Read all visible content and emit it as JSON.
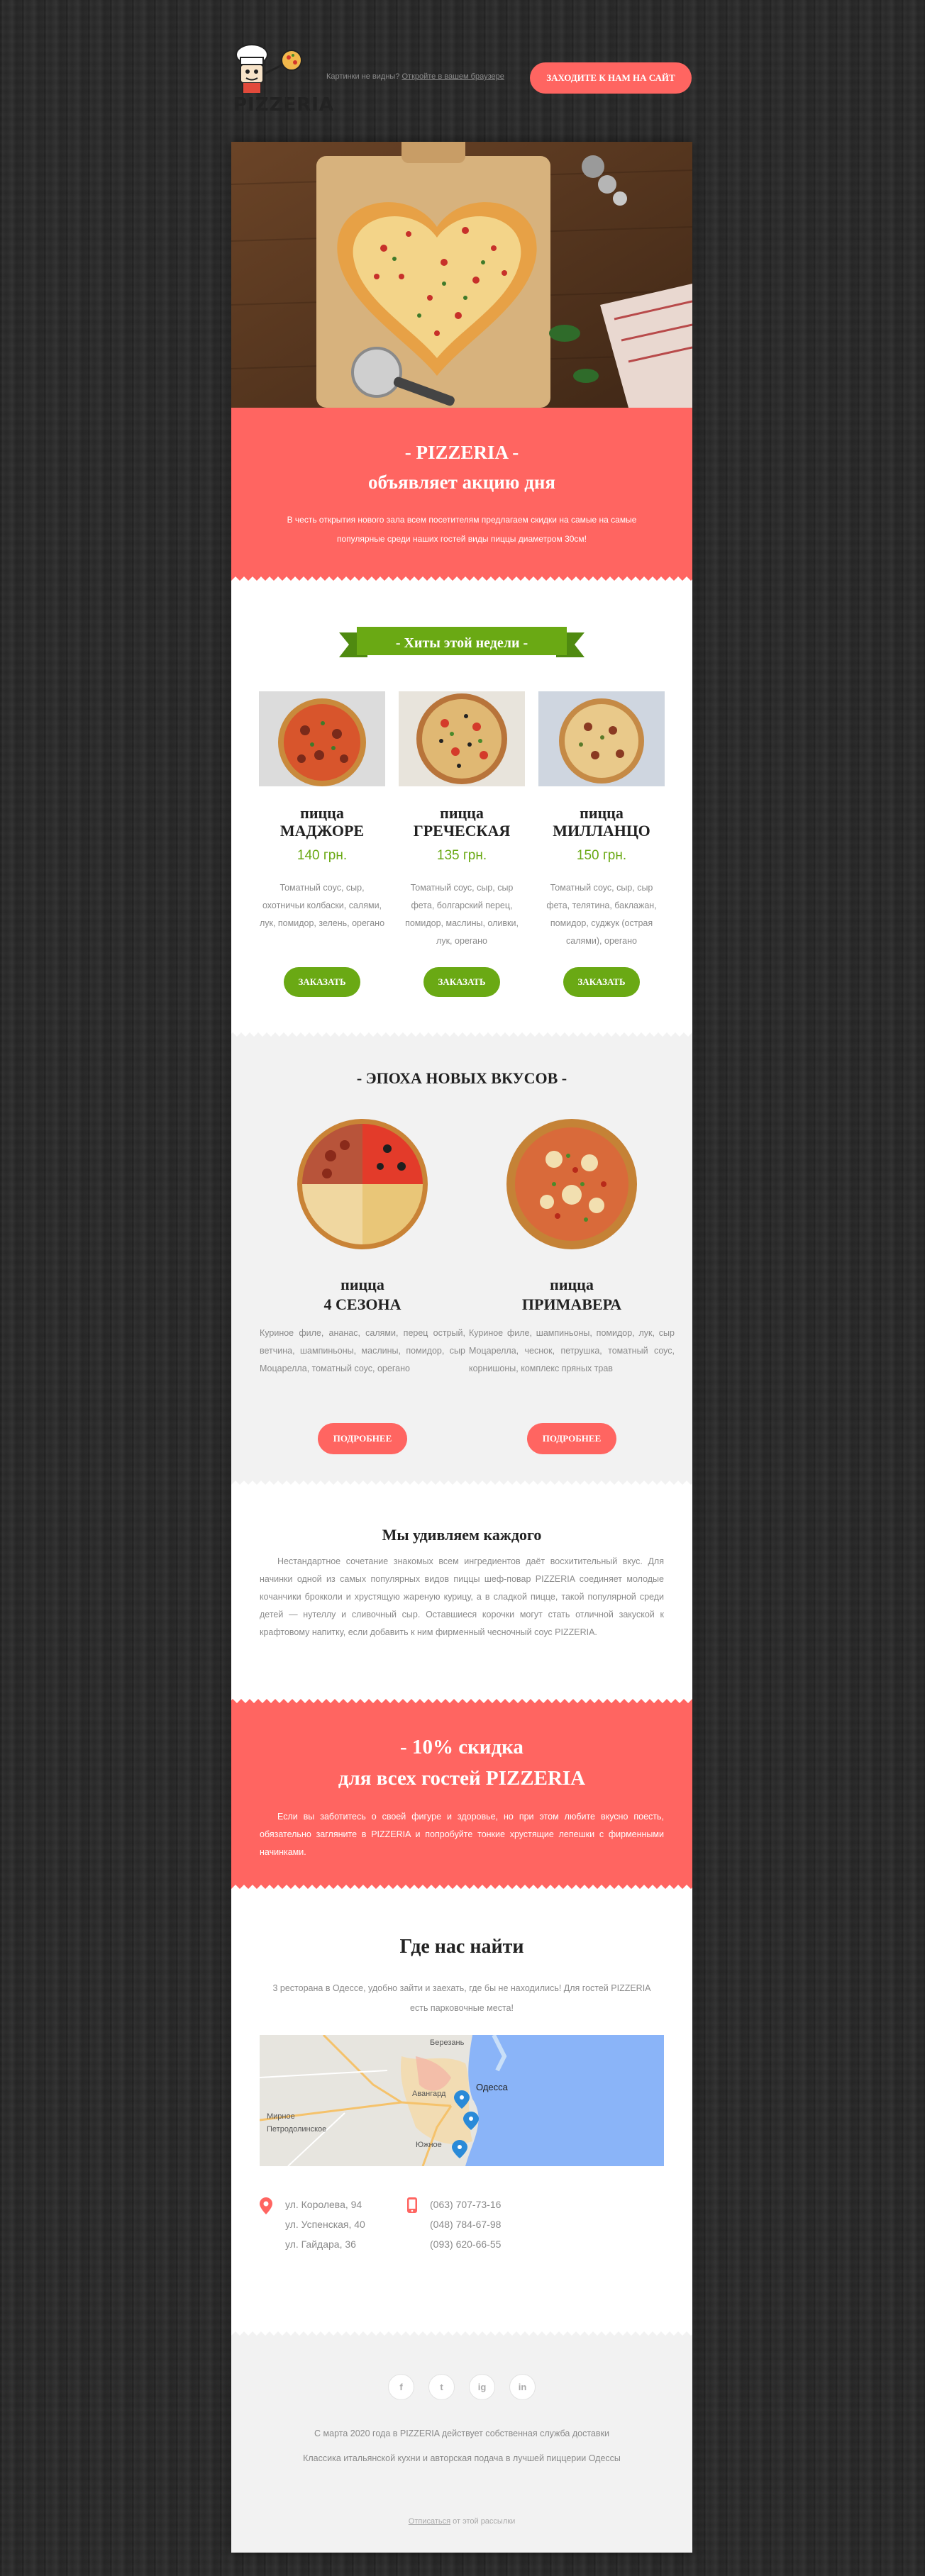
{
  "header": {
    "logo_text": "PIZZERIA",
    "preheader_prefix": "Картинки не видны? ",
    "preheader_link": "Откройте в вашем браузере",
    "cta": "ЗАХОДИТЕ К НАМ НА САЙТ"
  },
  "promo": {
    "title_line1": "- PIZZERIA -",
    "title_line2": "объявляет акцию дня",
    "text": "В честь открытия нового зала всем посетителям предлагаем скидки на самые на самые популярные среди наших гостей виды пиццы диаметром 30см!"
  },
  "hits": {
    "ribbon": "- Хиты этой недели -",
    "items": [
      {
        "name_line1": "пицца",
        "name_line2": "МАДЖОРЕ",
        "price": "140 грн.",
        "desc": "Томатный соус, сыр, охотничьи колбаски, салями, лук, помидор, зелень, орегано",
        "button": "ЗАКАЗАТЬ"
      },
      {
        "name_line1": "пицца",
        "name_line2": "ГРЕЧЕСКАЯ",
        "price": "135 грн.",
        "desc": "Томатный соус, сыр, сыр фета, болгарский перец, помидор, маслины, оливки, лук, орегано",
        "button": "ЗАКАЗАТЬ"
      },
      {
        "name_line1": "пицца",
        "name_line2": "МИЛЛАНЦО",
        "price": "150 грн.",
        "desc": "Томатный соус, сыр, сыр фета, телятина, баклажан, помидор, суджук (острая салями), орегано",
        "button": "ЗАКАЗАТЬ"
      }
    ]
  },
  "epoch": {
    "title": "- ЭПОХА НОВЫХ ВКУСОВ -",
    "items": [
      {
        "name_line1": "пицца",
        "name_line2": "4 СЕЗОНА",
        "desc": "Куриное филе, ананас, салями, перец острый, ветчина, шампиньоны, маслины, помидор, сыр Моцарелла, томатный соус, орегано",
        "button": "ПОДРОБНЕЕ"
      },
      {
        "name_line1": "пицца",
        "name_line2": "ПРИМАВЕРА",
        "desc": "Куриное филе, шампиньоны, помидор, лук, сыр Моцарелла, чеснок, петрушка, томатный соус, корнишоны, комплекс пряных трав",
        "button": "ПОДРОБНЕЕ"
      }
    ]
  },
  "surprise": {
    "title": "Мы удивляем каждого",
    "text": "Нестандартное сочетание знакомых всем ингредиентов даёт восхитительный вкус. Для начинки одной из самых популярных видов пиццы шеф-повар PIZZERIA соединяет молодые кочанчики брокколи и хрустящую жареную курицу, а в сладкой пицце, такой популярной среди детей — нутеллу и сливочный сыр. Оставшиеся корочки могут стать отличной закуской к крафтовому напитку, если добавить к ним фирменный чесночный соус PIZZERIA."
  },
  "discount": {
    "title_line1": "- 10% скидка",
    "title_line2": "для всех гостей PIZZERIA",
    "text": "Если вы заботитесь о своей фигуре и здоровье, но при этом любите вкусно поесть, обязательно загляните в PIZZERIA и попробуйте тонкие хрустящие лепешки с фирменными начинками."
  },
  "find": {
    "title": "Где нас найти",
    "intro": "3 ресторана в Одессе, удобно зайти и заехать, где бы не находились! Для гостей PIZZERIA есть парковочные места!",
    "map_labels": [
      "Березань",
      "Одесса",
      "Авангард",
      "Мирное",
      "Петродолинское",
      "Южное"
    ],
    "addresses": [
      "ул. Королева, 94",
      "ул. Успенская, 40",
      "ул. Гайдара, 36"
    ],
    "phones": [
      "(063) 707-73-16",
      "(048) 784-67-98",
      "(093) 620-66-55"
    ]
  },
  "footer": {
    "socials": [
      "f",
      "t",
      "ig",
      "in"
    ],
    "line1": "С марта 2020 года в PIZZERIA действует собственная служба доставки",
    "line2": "Классика итальянской кухни и авторская подача в лучшей пиццерии Одессы",
    "unsub_link": "Отписаться",
    "unsub_rest": " от этой рассылки"
  },
  "colors": {
    "accent": "#ff6561",
    "green": "#6aa914",
    "text_gray": "#8a8a8a"
  }
}
